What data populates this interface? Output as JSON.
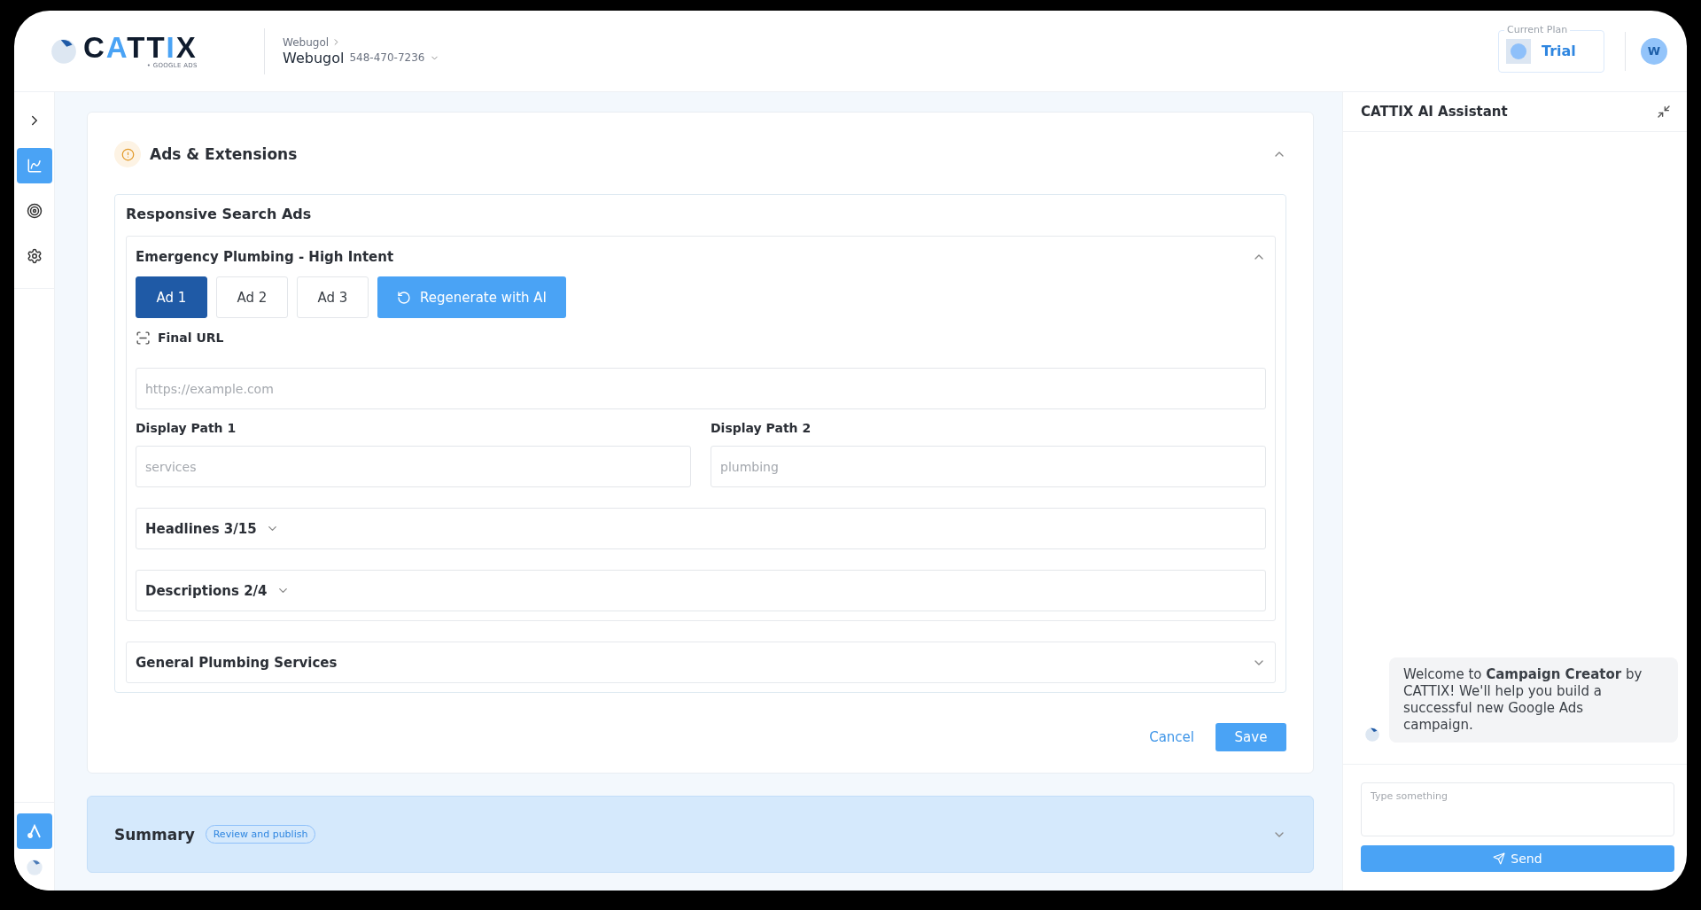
{
  "logo": {
    "parts": [
      {
        "text": "C",
        "accent": false
      },
      {
        "text": "A",
        "accent": true
      },
      {
        "text": "TT",
        "accent": false
      },
      {
        "text": "I",
        "accent": true
      },
      {
        "text": "X",
        "accent": false
      }
    ],
    "tagline": "• GOOGLE ADS"
  },
  "account": {
    "parent": "Webugol",
    "name": "Webugol",
    "id": "548-470-7236"
  },
  "plan": {
    "label": "Current Plan",
    "name": "Trial"
  },
  "user": {
    "initial": "W"
  },
  "sidebar": {
    "items": [
      {
        "kind": "expand",
        "selected": false
      },
      {
        "kind": "analytics",
        "selected": true
      },
      {
        "kind": "target",
        "selected": false
      },
      {
        "kind": "settings",
        "selected": false
      }
    ],
    "bottom_items": [
      {
        "kind": "ads",
        "selected": true
      },
      {
        "kind": "logo",
        "selected": false
      }
    ]
  },
  "section": {
    "title": "Ads & Extensions",
    "kind": "warning",
    "expanded": true
  },
  "rsa": {
    "title": "Responsive Search Ads",
    "groups": [
      {
        "name": "Emergency Plumbing - High Intent",
        "expanded": true,
        "ads": [
          {
            "label": "Ad 1",
            "selected": true
          },
          {
            "label": "Ad 2",
            "selected": false
          },
          {
            "label": "Ad 3",
            "selected": false
          }
        ],
        "regenerate": "Regenerate with AI",
        "final_url": {
          "label": "Final URL",
          "placeholder": "https://example.com"
        },
        "paths": [
          {
            "label": "Display Path 1",
            "placeholder": "services"
          },
          {
            "label": "Display Path 2",
            "placeholder": "plumbing"
          }
        ],
        "subsections": [
          {
            "title": "Headlines 3/15",
            "expanded": false
          },
          {
            "title": "Descriptions 2/4",
            "expanded": false
          }
        ]
      },
      {
        "name": "General Plumbing Services",
        "expanded": false
      }
    ]
  },
  "actions": {
    "cancel": "Cancel",
    "save": "Save"
  },
  "summary": {
    "title": "Summary",
    "badge": "Review and publish",
    "expanded": false
  },
  "assistant": {
    "title": "CATTIX AI Assistant",
    "messages": [
      {
        "text": "Welcome to **Campaign Creator** by CATTIX! We'll help you build a successful new Google Ads campaign."
      }
    ],
    "input": {
      "placeholder": "Type something"
    },
    "send": "Send"
  }
}
